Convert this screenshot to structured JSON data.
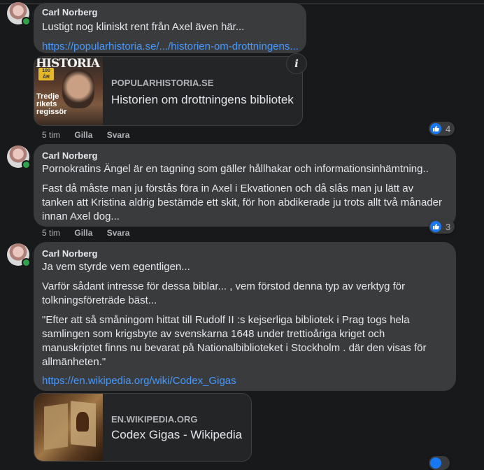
{
  "comments": [
    {
      "author": "Carl Norberg",
      "paragraphs": [
        "Lustigt nog kliniskt rent från Axel även här..."
      ],
      "link": "https://popularhistoria.se/.../historien-om-drottningens...",
      "time": "5 tim",
      "like": "Gilla",
      "reply": "Svara",
      "reaction_count": "4",
      "preview": {
        "domain": "POPULARHISTORIA.SE",
        "title": "Historien om drottningens bibliotek",
        "thumb_masthead": "HISTORIA",
        "thumb_badge": "100 ÅR",
        "thumb_text": "Tredje rikets regissör"
      }
    },
    {
      "author": "Carl Norberg",
      "paragraphs": [
        "Pornokratins Ängel är en tagning som gäller hållhakar och informationsinhämtning..",
        "Fast då måste man ju förstås föra in Axel i Ekvationen och då slås man ju lätt av tanken att Kristina aldrig bestämde ett skit, för hon abdikerade ju trots allt två månader innan Axel dog..."
      ],
      "time": "5 tim",
      "like": "Gilla",
      "reply": "Svara",
      "reaction_count": "3"
    },
    {
      "author": "Carl Norberg",
      "paragraphs": [
        "Ja vem styrde vem egentligen...",
        "Varför sådant intresse för dessa biblar... , vem förstod denna typ av verktyg för tolkningsföreträde bäst...",
        "\"Efter att så småningom hittat till Rudolf II :s kejserliga bibliotek i Prag togs hela samlingen som krigsbyte av svenskarna 1648 under trettioåriga kriget och manuskriptet finns nu bevarat på Nationalbiblioteket i Stockholm . där den visas för allmänheten.\""
      ],
      "link": "https://en.wikipedia.org/wiki/Codex_Gigas",
      "preview": {
        "domain": "EN.WIKIPEDIA.ORG",
        "title": "Codex Gigas - Wikipedia"
      }
    }
  ],
  "colors": {
    "background": "#18191a",
    "bubble": "#3a3b3c",
    "link": "#4599ff",
    "like_blue": "#1877f2",
    "online": "#31a24c"
  },
  "icons": [
    "avatar",
    "online-indicator-icon",
    "info-icon",
    "like-icon"
  ]
}
